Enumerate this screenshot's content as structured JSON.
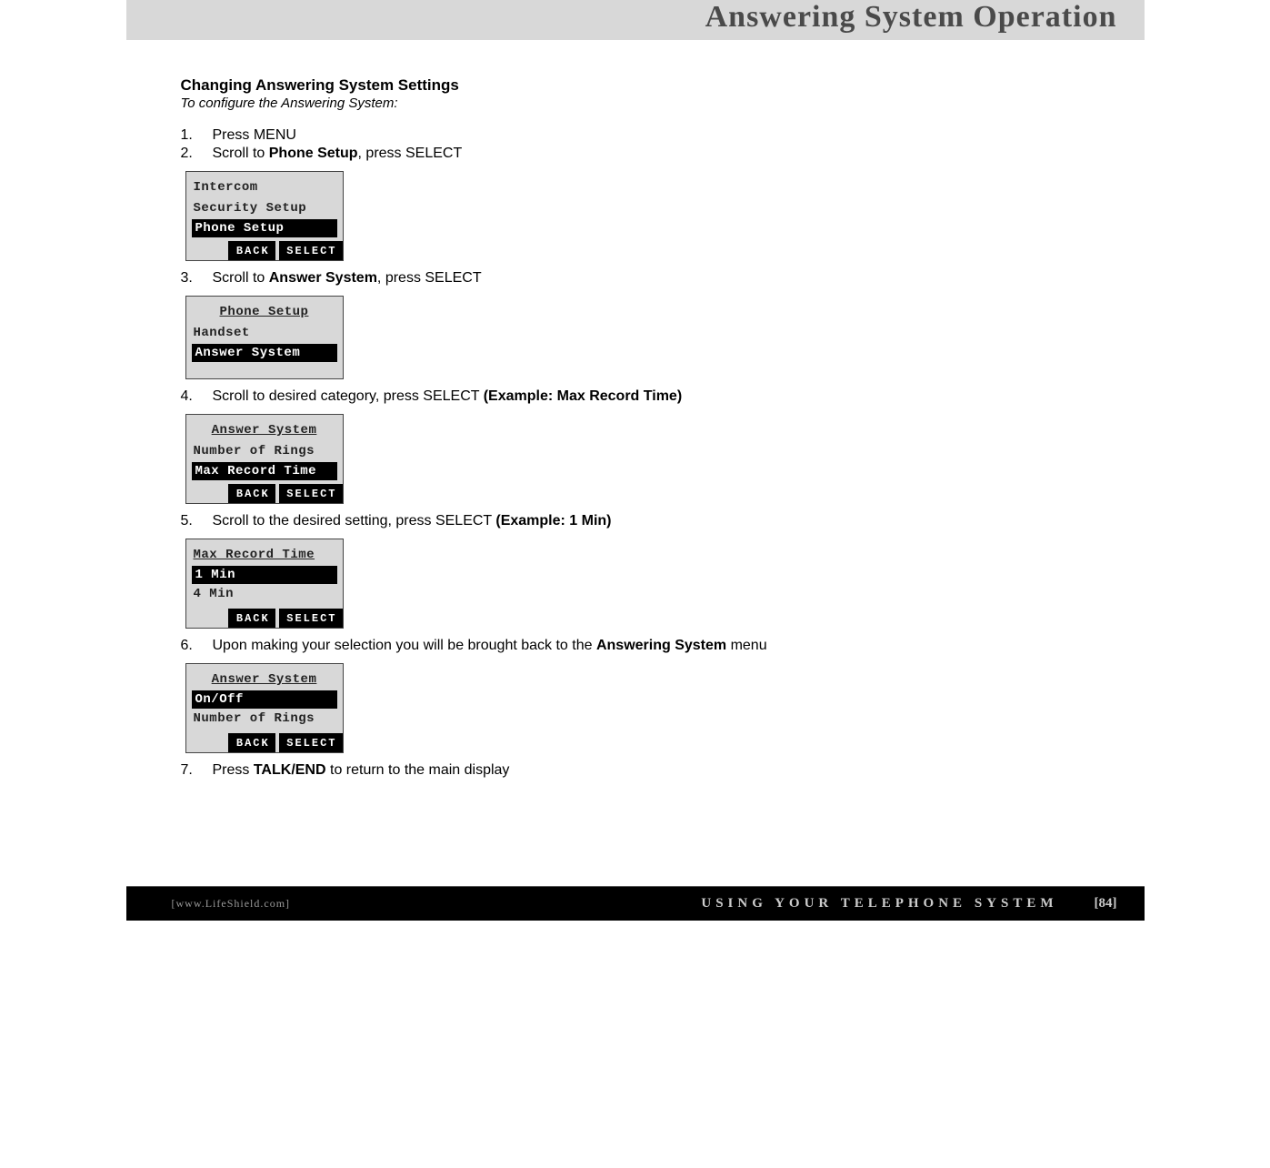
{
  "header": {
    "title": "Answering System Operation"
  },
  "section": {
    "heading": "Changing Answering System Settings",
    "subheading_prefix": "To configure the ",
    "subheading_italic": "Answering System",
    "subheading_suffix": ":"
  },
  "steps": {
    "s1": "Press MENU",
    "s2_pre": "Scroll to ",
    "s2_bold": "Phone Setup",
    "s2_post": ", press SELECT",
    "s3_pre": "Scroll to ",
    "s3_bold": "Answer System",
    "s3_post": ", press SELECT",
    "s4_pre": "Scroll to desired category, press SELECT ",
    "s4_bold": "(Example: Max Record Time)",
    "s5_pre": "Scroll to the desired setting, press SELECT ",
    "s5_bold": "(Example: 1 Min)",
    "s6_pre": "Upon making your selection you will be brought back to the ",
    "s6_bold": "Answering System",
    "s6_post": " menu",
    "s7_pre": "Press ",
    "s7_bold": "TALK/END",
    "s7_post": " to return to the main display"
  },
  "lcd1": {
    "row1": "Intercom",
    "row2": "Security Setup",
    "selected": "Phone Setup",
    "back": "BACK",
    "select": "SELECT"
  },
  "lcd2": {
    "title": "Phone Setup",
    "row1": "Handset",
    "selected": "Answer System"
  },
  "lcd3": {
    "title": "Answer System",
    "row1": "Number of Rings",
    "selected": "Max Record Time",
    "back": "BACK",
    "select": "SELECT"
  },
  "lcd4": {
    "title": "Max Record Time",
    "selected": "1 Min",
    "row2": "4 Min",
    "back": "BACK",
    "select": "SELECT"
  },
  "lcd5": {
    "title": "Answer System",
    "selected": "On/Off",
    "row2": "Number of Rings",
    "back": "BACK",
    "select": "SELECT"
  },
  "footer": {
    "url": "[www.LifeShield.com]",
    "section": "USING YOUR TELEPHONE SYSTEM",
    "page": "[84]"
  }
}
